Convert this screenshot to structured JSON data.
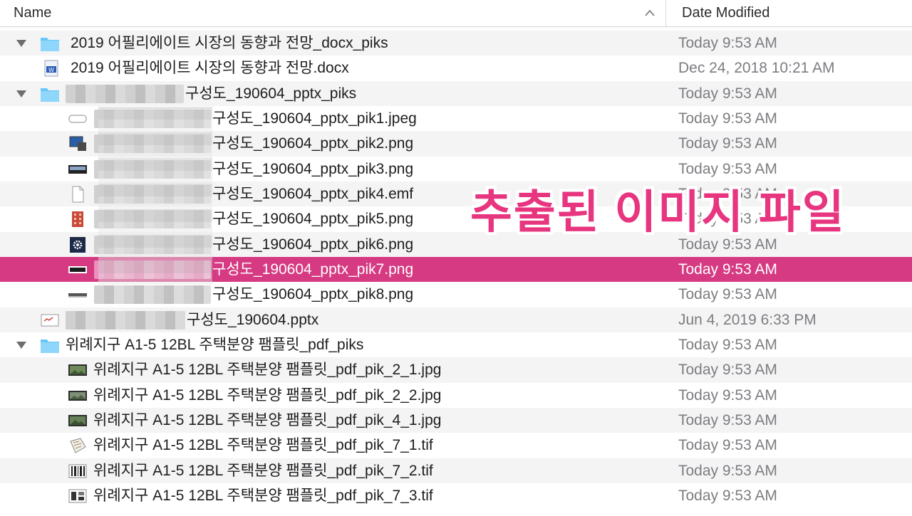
{
  "columns": {
    "name": "Name",
    "date": "Date Modified"
  },
  "overlay_text": "추출된 이미지 파일",
  "rows": [
    {
      "name": "2019 어필리에이트 시장의 동향과 전망_docx_piks",
      "date": "Today 9:53 AM",
      "icon": "folder-icon"
    },
    {
      "name": "2019 어필리에이트 시장의 동향과 전망.docx",
      "date": "Dec 24, 2018 10:21 AM",
      "icon": "word-doc-icon"
    },
    {
      "name": "구성도_190604_pptx_piks",
      "date": "Today 9:53 AM",
      "icon": "folder-icon"
    },
    {
      "name": "구성도_190604_pptx_pik1.jpeg",
      "date": "Today 9:53 AM",
      "icon": "image-thumb-icon"
    },
    {
      "name": "구성도_190604_pptx_pik2.png",
      "date": "Today 9:53 AM",
      "icon": "computer-thumb-icon"
    },
    {
      "name": "구성도_190604_pptx_pik3.png",
      "date": "Today 9:53 AM",
      "icon": "device-thumb-icon"
    },
    {
      "name": "구성도_190604_pptx_pik4.emf",
      "date": "Today 9:53 AM",
      "icon": "blank-file-icon"
    },
    {
      "name": "구성도_190604_pptx_pik5.png",
      "date": "Today 9:53 AM",
      "icon": "building-thumb-icon"
    },
    {
      "name": "구성도_190604_pptx_pik6.png",
      "date": "Today 9:53 AM",
      "icon": "gear-thumb-icon"
    },
    {
      "name": "구성도_190604_pptx_pik7.png",
      "date": "Today 9:53 AM",
      "icon": "bar-thumb-icon"
    },
    {
      "name": "구성도_190604_pptx_pik8.png",
      "date": "Today 9:53 AM",
      "icon": "line-thumb-icon"
    },
    {
      "name": "구성도_190604.pptx",
      "date": "Jun 4, 2019 6:33 PM",
      "icon": "pptx-doc-icon"
    },
    {
      "name": "위례지구 A1-5 12BL 주택분양 팸플릿_pdf_piks",
      "date": "Today 9:53 AM",
      "icon": "folder-icon"
    },
    {
      "name": "위례지구 A1-5 12BL 주택분양 팸플릿_pdf_pik_2_1.jpg",
      "date": "Today 9:53 AM",
      "icon": "photo-thumb-icon"
    },
    {
      "name": "위례지구 A1-5 12BL 주택분양 팸플릿_pdf_pik_2_2.jpg",
      "date": "Today 9:53 AM",
      "icon": "photo-thumb-icon"
    },
    {
      "name": "위례지구 A1-5 12BL 주택분양 팸플릿_pdf_pik_4_1.jpg",
      "date": "Today 9:53 AM",
      "icon": "photo-thumb-icon"
    },
    {
      "name": "위례지구 A1-5 12BL 주택분양 팸플릿_pdf_pik_7_1.tif",
      "date": "Today 9:53 AM",
      "icon": "map-thumb-icon"
    },
    {
      "name": "위례지구 A1-5 12BL 주택분양 팸플릿_pdf_pik_7_2.tif",
      "date": "Today 9:53 AM",
      "icon": "barcode-thumb-icon"
    },
    {
      "name": "위례지구 A1-5 12BL 주택분양 팸플릿_pdf_pik_7_3.tif",
      "date": "Today 9:53 AM",
      "icon": "plan-thumb-icon"
    }
  ],
  "colors": {
    "selection": "#d63a82",
    "overlay": "#e8357f",
    "folder": "#5ec3f7",
    "date_text": "#7d7d82"
  }
}
